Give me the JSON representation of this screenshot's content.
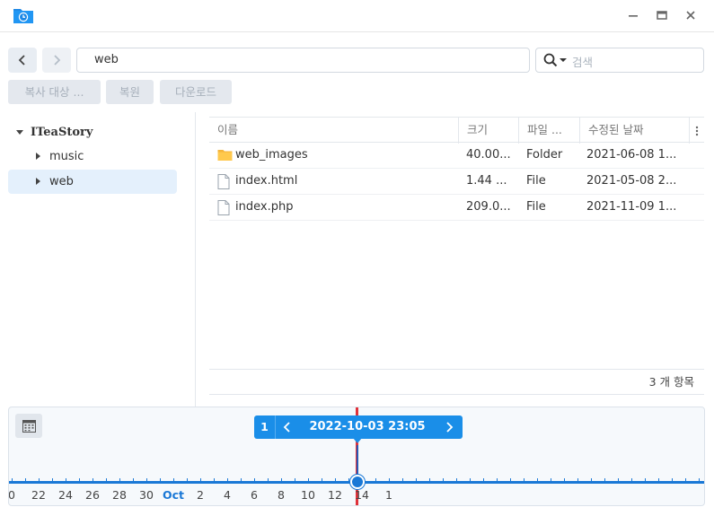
{
  "window": {
    "app_icon": "backup-explorer-icon",
    "controls": [
      "minimize-icon",
      "maximize-icon",
      "close-icon"
    ]
  },
  "toolbar": {
    "path": "web",
    "search_placeholder": "검색",
    "copy_to_label": "복사 대상 ...",
    "restore_label": "복원",
    "download_label": "다운로드"
  },
  "tree": {
    "root": "ITeaStory",
    "items": [
      {
        "label": "music",
        "selected": false
      },
      {
        "label": "web",
        "selected": true
      }
    ]
  },
  "file_list": {
    "columns": [
      "이름",
      "크기",
      "파일 ...",
      "수정된 날짜"
    ],
    "rows": [
      {
        "icon": "folder-icon",
        "name": "web_images",
        "size": "40.00...",
        "type": "Folder",
        "date": "2021-06-08 1..."
      },
      {
        "icon": "file-icon",
        "name": "index.html",
        "size": "1.44 ...",
        "type": "File",
        "date": "2021-05-08 2..."
      },
      {
        "icon": "file-icon",
        "name": "index.php",
        "size": "209.0...",
        "type": "File",
        "date": "2021-11-09 1..."
      }
    ],
    "item_count": "3 개 항목"
  },
  "timeline": {
    "version_count": "1",
    "current_datetime": "2022-10-03 23:05",
    "ticks": [
      {
        "label": "0"
      },
      {
        "label": "22"
      },
      {
        "label": "24"
      },
      {
        "label": "26"
      },
      {
        "label": "28"
      },
      {
        "label": "30"
      },
      {
        "label": "Oct",
        "month": true
      },
      {
        "label": "2"
      },
      {
        "label": "4"
      },
      {
        "label": "6"
      },
      {
        "label": "8"
      },
      {
        "label": "10"
      },
      {
        "label": "12"
      },
      {
        "label": "14"
      },
      {
        "label": "1"
      }
    ],
    "accent_color": "#1a8ee8",
    "marker_color": "#e0323a"
  }
}
